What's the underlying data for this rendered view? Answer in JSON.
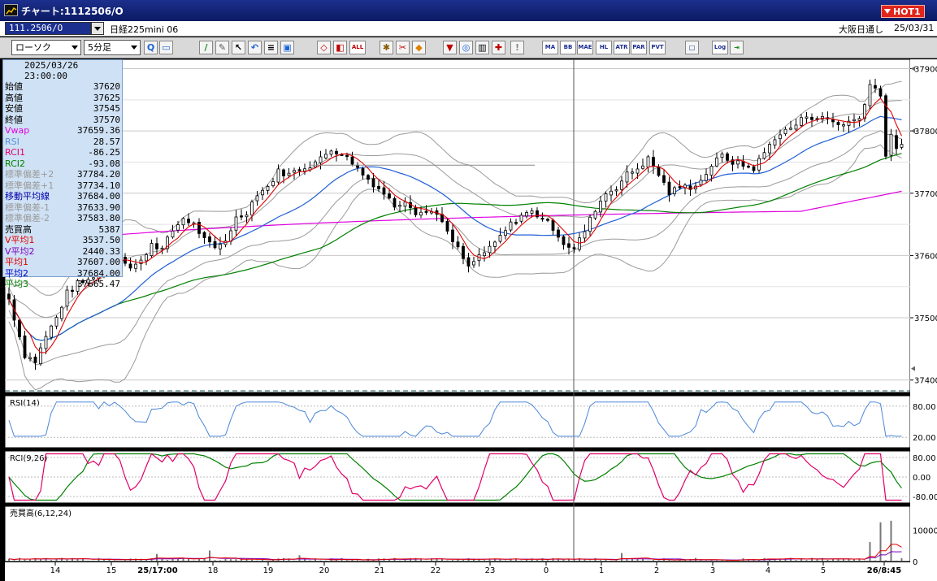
{
  "window": {
    "title": "チャート:1112506/O",
    "hot_label": "HOT1"
  },
  "infobar": {
    "symbol": "111.2506/O",
    "instrument_name": "日経225mini 06",
    "session": "大阪日通し",
    "date": "25/03/31"
  },
  "toolbar": {
    "chart_type": "ローソク",
    "timeframe": "5分足",
    "text_buttons": [
      "ALL",
      "MA",
      "BB",
      "MAE",
      "HL",
      "ATR",
      "PAR",
      "PVT",
      "Log"
    ]
  },
  "info_panel": {
    "timestamp": "2025/03/26 23:00:00",
    "rows": [
      {
        "label": "始値",
        "value": "37620",
        "color": "#000000"
      },
      {
        "label": "高値",
        "value": "37625",
        "color": "#000000"
      },
      {
        "label": "安値",
        "value": "37545",
        "color": "#000000"
      },
      {
        "label": "終値",
        "value": "37570",
        "color": "#000000"
      },
      {
        "label": "Vwap",
        "value": "37659.36",
        "color": "#e000e0"
      },
      {
        "label": "RSI",
        "value": "28.57",
        "color": "#5b8fd8"
      },
      {
        "label": "RCI1",
        "value": "-86.25",
        "color": "#e0006a"
      },
      {
        "label": "RCI2",
        "value": "-93.08",
        "color": "#008000"
      },
      {
        "label": "標準偏差+2",
        "value": "37784.20",
        "color": "#9a9a9a"
      },
      {
        "label": "標準偏差+1",
        "value": "37734.10",
        "color": "#9a9a9a"
      },
      {
        "label": "移動平均線",
        "value": "37684.00",
        "color": "#0000aa"
      },
      {
        "label": "標準偏差-1",
        "value": "37633.90",
        "color": "#9a9a9a"
      },
      {
        "label": "標準偏差-2",
        "value": "37583.80",
        "color": "#9a9a9a"
      },
      {
        "label": "売買高",
        "value": "5387",
        "color": "#000000"
      },
      {
        "label": "V平均1",
        "value": "3537.50",
        "color": "#e00000"
      },
      {
        "label": "V平均2",
        "value": "2440.33",
        "color": "#8000c0"
      },
      {
        "label": "平均1",
        "value": "37607.00",
        "color": "#e00000"
      },
      {
        "label": "平均2",
        "value": "37684.00",
        "color": "#0000cc"
      },
      {
        "label": "平均3",
        "value": "37665.47",
        "color": "#008000"
      }
    ]
  },
  "price_axis": {
    "ticks": [
      "37900",
      "37800",
      "37700",
      "37600",
      "37500",
      "37400"
    ]
  },
  "rsi_panel": {
    "label": "RSI(14)",
    "ticks": [
      "80.00",
      "20.00"
    ]
  },
  "rci_panel": {
    "label": "RCI(9,26)",
    "ticks": [
      "80.00",
      "0.00",
      "-80.00"
    ]
  },
  "volume_panel": {
    "label": "売買高(6,12,24)",
    "ticks": [
      "10000",
      "0"
    ]
  },
  "time_axis": {
    "labels": [
      "14",
      "15",
      "25/17:00",
      "18",
      "19",
      "20",
      "21",
      "22",
      "23",
      "0",
      "1",
      "2",
      "3",
      "4",
      "5",
      "26/8:45"
    ]
  },
  "colors": {
    "up": "#ffffff",
    "down": "#000000",
    "ma1": "#e00000",
    "ma2": "#1f5fd6",
    "ma3": "#008000",
    "vwap": "#e000e0",
    "bands": "#9a9a9a",
    "rsi": "#4a86d8",
    "rci_fast": "#e0006a",
    "rci_slow": "#008000"
  },
  "chart_data": {
    "type": "candlestick",
    "price_range": [
      37380,
      37915
    ],
    "close_path": [
      [
        0,
        37530
      ],
      [
        3,
        37440
      ],
      [
        5,
        37430
      ],
      [
        7,
        37470
      ],
      [
        9,
        37500
      ],
      [
        11,
        37540
      ],
      [
        13,
        37555
      ],
      [
        15,
        37560
      ],
      [
        17,
        37575
      ],
      [
        19,
        37600
      ],
      [
        21,
        37600
      ],
      [
        23,
        37580
      ],
      [
        25,
        37590
      ],
      [
        27,
        37620
      ],
      [
        29,
        37610
      ],
      [
        31,
        37640
      ],
      [
        33,
        37660
      ],
      [
        35,
        37650
      ],
      [
        37,
        37625
      ],
      [
        39,
        37610
      ],
      [
        41,
        37625
      ],
      [
        43,
        37660
      ],
      [
        45,
        37670
      ],
      [
        47,
        37700
      ],
      [
        49,
        37710
      ],
      [
        51,
        37735
      ],
      [
        53,
        37730
      ],
      [
        55,
        37740
      ],
      [
        57,
        37745
      ],
      [
        59,
        37755
      ],
      [
        61,
        37770
      ],
      [
        63,
        37765
      ],
      [
        65,
        37750
      ],
      [
        67,
        37730
      ],
      [
        69,
        37715
      ],
      [
        71,
        37700
      ],
      [
        73,
        37680
      ],
      [
        75,
        37690
      ],
      [
        77,
        37670
      ],
      [
        79,
        37670
      ],
      [
        81,
        37670
      ],
      [
        83,
        37635
      ],
      [
        85,
        37610
      ],
      [
        87,
        37580
      ],
      [
        89,
        37600
      ],
      [
        91,
        37610
      ],
      [
        93,
        37630
      ],
      [
        95,
        37650
      ],
      [
        97,
        37665
      ],
      [
        99,
        37670
      ],
      [
        101,
        37660
      ],
      [
        103,
        37645
      ],
      [
        105,
        37620
      ],
      [
        107,
        37610
      ],
      [
        109,
        37640
      ],
      [
        111,
        37675
      ],
      [
        113,
        37700
      ],
      [
        115,
        37710
      ],
      [
        117,
        37730
      ],
      [
        119,
        37740
      ],
      [
        121,
        37755
      ],
      [
        123,
        37730
      ],
      [
        125,
        37700
      ],
      [
        127,
        37710
      ],
      [
        129,
        37710
      ],
      [
        131,
        37720
      ],
      [
        133,
        37745
      ],
      [
        135,
        37760
      ],
      [
        137,
        37750
      ],
      [
        139,
        37745
      ],
      [
        141,
        37740
      ],
      [
        143,
        37765
      ],
      [
        145,
        37790
      ],
      [
        147,
        37800
      ],
      [
        149,
        37810
      ],
      [
        151,
        37825
      ],
      [
        153,
        37820
      ],
      [
        155,
        37820
      ],
      [
        157,
        37810
      ],
      [
        159,
        37815
      ],
      [
        161,
        37820
      ],
      [
        163,
        37875
      ],
      [
        165,
        37860
      ],
      [
        166,
        37760
      ],
      [
        167,
        37790
      ],
      [
        168,
        37775
      ]
    ],
    "volume_spikes": [
      [
        28,
        2400
      ],
      [
        38,
        3500
      ],
      [
        55,
        2000
      ],
      [
        116,
        2700
      ],
      [
        163,
        6200
      ],
      [
        165,
        12500
      ],
      [
        167,
        13000
      ]
    ]
  }
}
